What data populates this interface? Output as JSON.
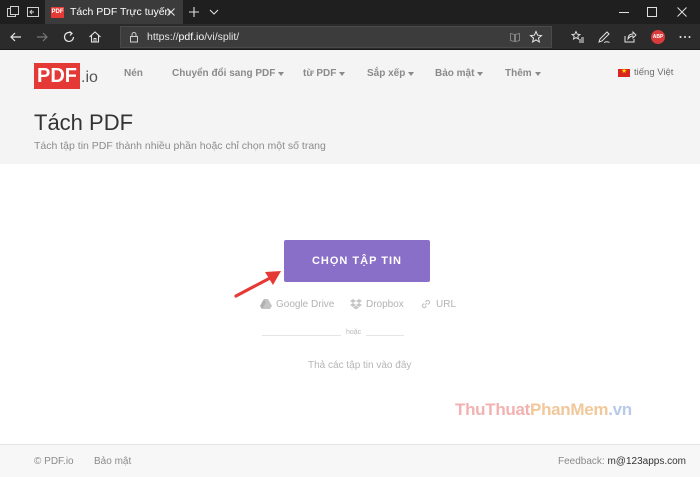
{
  "browser": {
    "tab_title": "Tách PDF Trực tuyến - Tí",
    "tab_favicon_text": "PDF",
    "url_prefix": "https://",
    "url_host": "pdf.io",
    "url_path": "/vi/split/",
    "adblock_label": "ABP"
  },
  "site": {
    "logo_main": "PDF",
    "logo_suffix": ".io",
    "menu": [
      {
        "label": "Nén"
      },
      {
        "label": "Chuyển đổi sang PDF"
      },
      {
        "label": "từ PDF"
      },
      {
        "label": "Sắp xếp"
      },
      {
        "label": "Bảo mật"
      },
      {
        "label": "Thêm"
      }
    ],
    "language": "tiếng Việt"
  },
  "page": {
    "title": "Tách PDF",
    "subtitle": "Tách tập tin PDF thành nhiều phần hoặc chỉ chọn một số trang"
  },
  "upload": {
    "choose_button": "CHỌN TẬP TIN",
    "sources": [
      {
        "label": "Google Drive",
        "icon": "google-drive-icon"
      },
      {
        "label": "Dropbox",
        "icon": "dropbox-icon"
      },
      {
        "label": "URL",
        "icon": "link-icon"
      }
    ],
    "or_text": "hoặc",
    "drop_text": "Thả các tập tin vào đây"
  },
  "watermark": {
    "part1": "ThuThuat",
    "part2": "PhanMem",
    "part3": ".vn"
  },
  "footer": {
    "copyright": "© PDF.io",
    "security": "Bảo mật",
    "feedback_label": "Feedback: ",
    "feedback_email": "m@123apps.com"
  },
  "colors": {
    "accent_button": "#8a6fc9",
    "logo_red": "#e53935",
    "arrow_red": "#e53935"
  }
}
